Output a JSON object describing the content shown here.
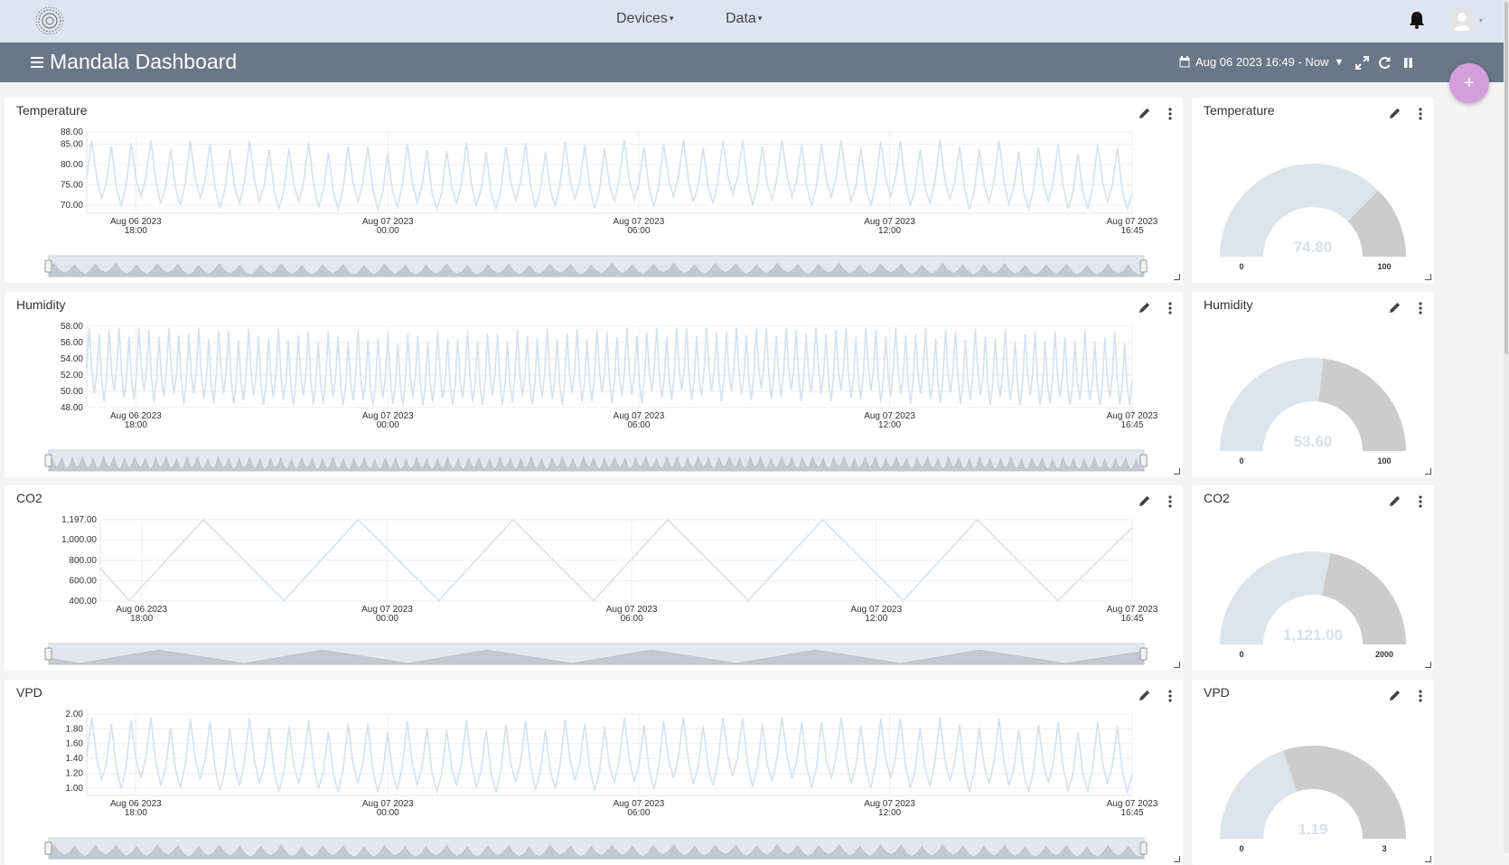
{
  "nav": {
    "devices_label": "Devices",
    "data_label": "Data"
  },
  "header": {
    "title": "Mandala Dashboard",
    "date_range": "Aug 06 2023 16:49 - Now"
  },
  "fab_label": "+",
  "colors": {
    "topbar": "#dde6f0",
    "titlebar": "#6b7688",
    "line": "#d7e1ed",
    "navigator_fill": "#c3c9d3",
    "gauge_value": "#dce4ee",
    "gauge_rest": "#cccccc",
    "fab": "#d39fdb"
  },
  "panels": [
    {
      "title": "Temperature",
      "chart_data": {
        "type": "line",
        "y_ticks": [
          "88.00",
          "85.00",
          "80.00",
          "75.00",
          "70.00"
        ],
        "y_tick_values": [
          88,
          85,
          80,
          75,
          70
        ],
        "ylim": [
          68,
          88
        ],
        "x_ticks": [
          [
            "Aug 06 2023",
            "18:00"
          ],
          [
            "Aug 07 2023",
            "00:00"
          ],
          [
            "Aug 07 2023",
            "06:00"
          ],
          [
            "Aug 07 2023",
            "12:00"
          ],
          [
            "Aug 07 2023",
            "16:45"
          ]
        ],
        "pattern": "oscillating",
        "cycles": 53,
        "min": 69,
        "max": 86
      },
      "gauge": {
        "title": "Temperature",
        "value": 74.8,
        "display": "74.80",
        "min": 0,
        "max": 100,
        "min_label": "0",
        "max_label": "100"
      }
    },
    {
      "title": "Humidity",
      "chart_data": {
        "type": "line",
        "y_ticks": [
          "58.00",
          "56.00",
          "54.00",
          "52.00",
          "50.00",
          "48.00"
        ],
        "y_tick_values": [
          58,
          56,
          54,
          52,
          50,
          48
        ],
        "ylim": [
          48,
          58
        ],
        "x_ticks": [
          [
            "Aug 06 2023",
            "18:00"
          ],
          [
            "Aug 07 2023",
            "00:00"
          ],
          [
            "Aug 07 2023",
            "06:00"
          ],
          [
            "Aug 07 2023",
            "12:00"
          ],
          [
            "Aug 07 2023",
            "16:45"
          ]
        ],
        "pattern": "oscillating",
        "cycles": 105,
        "min": 48.3,
        "max": 57.8
      },
      "gauge": {
        "title": "Humidity",
        "value": 53.6,
        "display": "53.60",
        "min": 0,
        "max": 100,
        "min_label": "0",
        "max_label": "100"
      }
    },
    {
      "title": "CO2",
      "chart_data": {
        "type": "line",
        "y_ticks": [
          "1,197.00",
          "1,000.00",
          "800.00",
          "600.00",
          "400.00"
        ],
        "y_tick_values": [
          1197,
          1000,
          800,
          600,
          400
        ],
        "ylim": [
          400,
          1197
        ],
        "x_ticks": [
          [
            "Aug 06 2023",
            "18:00"
          ],
          [
            "Aug 07 2023",
            "00:00"
          ],
          [
            "Aug 07 2023",
            "06:00"
          ],
          [
            "Aug 07 2023",
            "12:00"
          ],
          [
            "Aug 07 2023",
            "16:45"
          ]
        ],
        "pattern": "triangle",
        "points": [
          [
            0,
            720
          ],
          [
            0.028,
            405
          ],
          [
            0.1,
            1197
          ],
          [
            0.178,
            405
          ],
          [
            0.25,
            1197
          ],
          [
            0.328,
            405
          ],
          [
            0.4,
            1197
          ],
          [
            0.478,
            405
          ],
          [
            0.55,
            1197
          ],
          [
            0.628,
            405
          ],
          [
            0.7,
            1197
          ],
          [
            0.778,
            405
          ],
          [
            0.85,
            1197
          ],
          [
            0.928,
            405
          ],
          [
            1.0,
            1121
          ]
        ]
      },
      "gauge": {
        "title": "CO2",
        "value": 1121,
        "display": "1,121.00",
        "min": 0,
        "max": 2000,
        "min_label": "0",
        "max_label": "2000"
      }
    },
    {
      "title": "VPD",
      "chart_data": {
        "type": "line",
        "y_ticks": [
          "2.00",
          "1.80",
          "1.60",
          "1.40",
          "1.20",
          "1.00"
        ],
        "y_tick_values": [
          2.0,
          1.8,
          1.6,
          1.4,
          1.2,
          1.0
        ],
        "ylim": [
          0.9,
          2.0
        ],
        "x_ticks": [
          [
            "Aug 06 2023",
            "18:00"
          ],
          [
            "Aug 07 2023",
            "00:00"
          ],
          [
            "Aug 07 2023",
            "06:00"
          ],
          [
            "Aug 07 2023",
            "12:00"
          ],
          [
            "Aug 07 2023",
            "16:45"
          ]
        ],
        "pattern": "oscillating",
        "cycles": 53,
        "min": 0.95,
        "max": 1.95
      },
      "gauge": {
        "title": "VPD",
        "value": 1.19,
        "display": "1.19",
        "min": 0,
        "max": 3,
        "min_label": "0",
        "max_label": "3"
      }
    }
  ]
}
